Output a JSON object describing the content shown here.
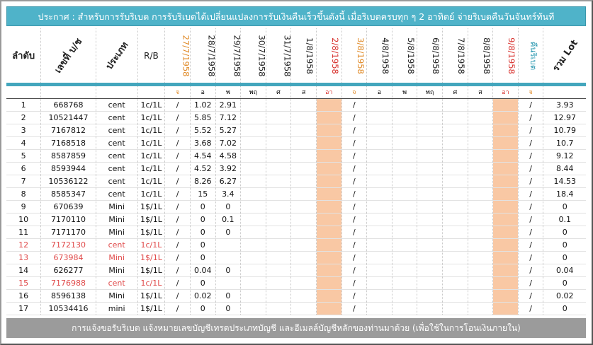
{
  "announcement": "ประกาศ : สำหรับการรับริเบต  การรับริเบตได้เปลี่ยนแปลงการรับเงินคืนเร็วขึ้นดังนี้   เมื่อริเบตครบทุก ๆ 2 อาทิตย์ จ่ายริเบตคืนวันจันทร์ทันที",
  "headers": {
    "order": "ลำดับ",
    "account": "เลขที่ บ/ช",
    "type": "ประเภท",
    "rb": "R/B",
    "dates": [
      "27/7/1958",
      "28/7/1958",
      "29/7/1958",
      "30/7/1958",
      "31/7/1958",
      "1/8/1958",
      "2/8/1958",
      "3/8/1958",
      "4/8/1958",
      "5/8/1958",
      "6/8/1958",
      "7/8/1958",
      "8/8/1958",
      "9/8/1958"
    ],
    "refund": "คืนริเบต",
    "total": "รวม Lot"
  },
  "days": [
    "จ",
    "อ",
    "พ",
    "พฤ",
    "ศ",
    "ส",
    "อา",
    "จ",
    "อ",
    "พ",
    "พฤ",
    "ศ",
    "ส",
    "อา",
    "จ"
  ],
  "colors": {
    "teal": "#4fb3c9",
    "peach": "#f9c8a4",
    "red": "#e04a4a",
    "orange": "#e08a27",
    "footer": "#9b9b9b"
  },
  "rows": [
    {
      "no": "1",
      "acc": "668768",
      "type": "cent",
      "rb": "1c/1L",
      "d1": "/",
      "d2": "1.02",
      "d3": "2.91",
      "s1": "/",
      "s2": "/",
      "total": "3.93",
      "red": false
    },
    {
      "no": "2",
      "acc": "10521447",
      "type": "cent",
      "rb": "1c/1L",
      "d1": "/",
      "d2": "5.85",
      "d3": "7.12",
      "s1": "/",
      "s2": "/",
      "total": "12.97",
      "red": false
    },
    {
      "no": "3",
      "acc": "7167812",
      "type": "cent",
      "rb": "1c/1L",
      "d1": "/",
      "d2": "5.52",
      "d3": "5.27",
      "s1": "/",
      "s2": "/",
      "total": "10.79",
      "red": false
    },
    {
      "no": "4",
      "acc": "7168518",
      "type": "cent",
      "rb": "1c/1L",
      "d1": "/",
      "d2": "3.68",
      "d3": "7.02",
      "s1": "/",
      "s2": "/",
      "total": "10.7",
      "red": false
    },
    {
      "no": "5",
      "acc": "8587859",
      "type": "cent",
      "rb": "1c/1L",
      "d1": "/",
      "d2": "4.54",
      "d3": "4.58",
      "s1": "/",
      "s2": "/",
      "total": "9.12",
      "red": false
    },
    {
      "no": "6",
      "acc": "8593944",
      "type": "cent",
      "rb": "1c/1L",
      "d1": "/",
      "d2": "4.52",
      "d3": "3.92",
      "s1": "/",
      "s2": "/",
      "total": "8.44",
      "red": false
    },
    {
      "no": "7",
      "acc": "10536122",
      "type": "cent",
      "rb": "1c/1L",
      "d1": "/",
      "d2": "8.26",
      "d3": "6.27",
      "s1": "/",
      "s2": "/",
      "total": "14.53",
      "red": false
    },
    {
      "no": "8",
      "acc": "8585347",
      "type": "cent",
      "rb": "1c/1L",
      "d1": "/",
      "d2": "15",
      "d3": "3.4",
      "s1": "/",
      "s2": "/",
      "total": "18.4",
      "red": false
    },
    {
      "no": "9",
      "acc": "670639",
      "type": "Mini",
      "rb": "1$/1L",
      "d1": "/",
      "d2": "0",
      "d3": "0",
      "s1": "/",
      "s2": "/",
      "total": "0",
      "red": false
    },
    {
      "no": "10",
      "acc": "7170110",
      "type": "Mini",
      "rb": "1$/1L",
      "d1": "/",
      "d2": "0",
      "d3": "0.1",
      "s1": "/",
      "s2": "/",
      "total": "0.1",
      "red": false
    },
    {
      "no": "11",
      "acc": "7171170",
      "type": "Mini",
      "rb": "1$/1L",
      "d1": "/",
      "d2": "0",
      "d3": "0",
      "s1": "/",
      "s2": "/",
      "total": "0",
      "red": false
    },
    {
      "no": "12",
      "acc": "7172130",
      "type": "cent",
      "rb": "1c/1L",
      "d1": "/",
      "d2": "0",
      "d3": "",
      "s1": "/",
      "s2": "/",
      "total": "0",
      "red": true
    },
    {
      "no": "13",
      "acc": "673984",
      "type": "Mini",
      "rb": "1$/1L",
      "d1": "/",
      "d2": "0",
      "d3": "",
      "s1": "/",
      "s2": "/",
      "total": "0",
      "red": true
    },
    {
      "no": "14",
      "acc": "626277",
      "type": "Mini",
      "rb": "1$/1L",
      "d1": "/",
      "d2": "0.04",
      "d3": "0",
      "s1": "/",
      "s2": "/",
      "total": "0.04",
      "red": false
    },
    {
      "no": "15",
      "acc": "7176988",
      "type": "cent",
      "rb": "1c/1L",
      "d1": "/",
      "d2": "0",
      "d3": "",
      "s1": "/",
      "s2": "/",
      "total": "0",
      "red": true
    },
    {
      "no": "16",
      "acc": "8596138",
      "type": "Mini",
      "rb": "1$/1L",
      "d1": "/",
      "d2": "0.02",
      "d3": "0",
      "s1": "/",
      "s2": "/",
      "total": "0.02",
      "red": false
    },
    {
      "no": "17",
      "acc": "10534416",
      "type": "mini",
      "rb": "1$/1L",
      "d1": "/",
      "d2": "0",
      "d3": "0",
      "s1": "/",
      "s2": "/",
      "total": "0",
      "red": false
    }
  ],
  "footer": "การแจ้งขอรับริเบต   แจ้งหมายเลขบัญชีเทรดประเภทบัญชี และอีเมลล์บัญชีหลักของท่านมาด้วย   (เพื่อใช้ในการโอนเงินภายใน)"
}
